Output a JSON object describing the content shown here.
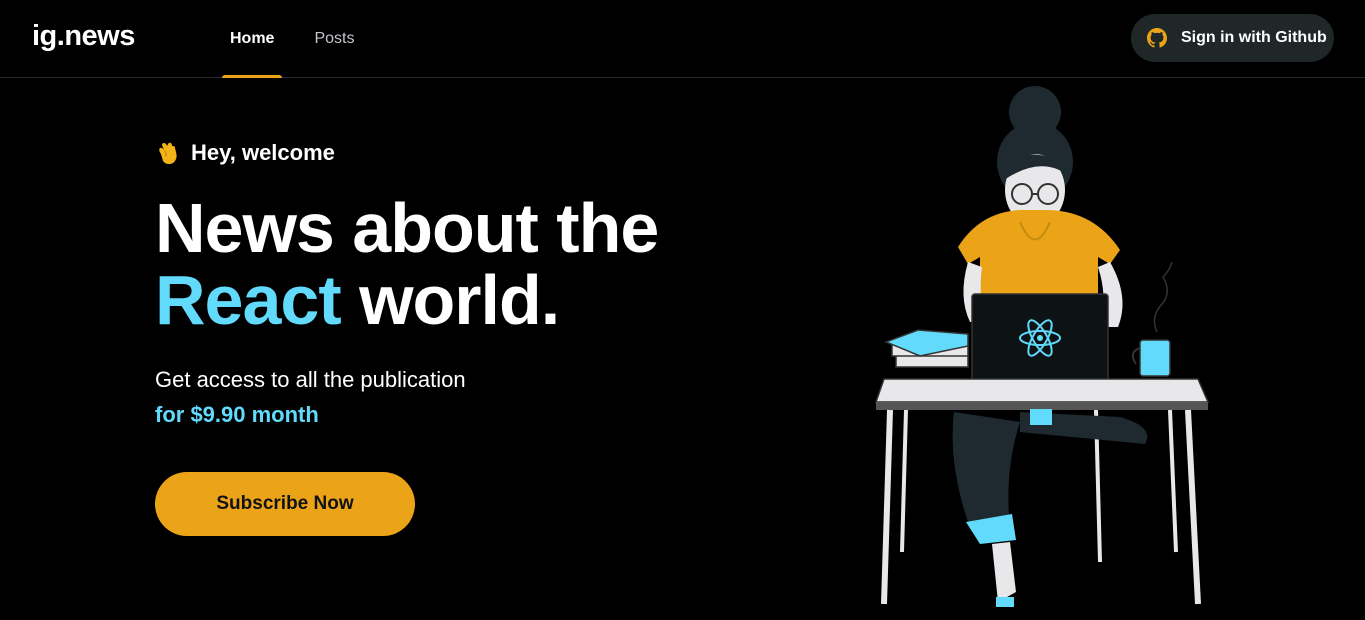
{
  "header": {
    "logo": "ig.news",
    "nav": [
      {
        "label": "Home",
        "active": true
      },
      {
        "label": "Posts",
        "active": false
      }
    ],
    "signin_label": "Sign in with Github",
    "signin_icon": "github-icon"
  },
  "hero": {
    "welcome": "Hey, welcome",
    "welcome_icon": "waving-hand-icon",
    "headline_line1": "News about the",
    "headline_accent": "React",
    "headline_rest": " world.",
    "subtitle": "Get access to all the publication",
    "price": "for $9.90 month",
    "cta": "Subscribe Now"
  },
  "colors": {
    "background": "#000000",
    "accent_yellow": "#eba417",
    "accent_cyan": "#61dafb",
    "button_dark": "#1f2729"
  }
}
